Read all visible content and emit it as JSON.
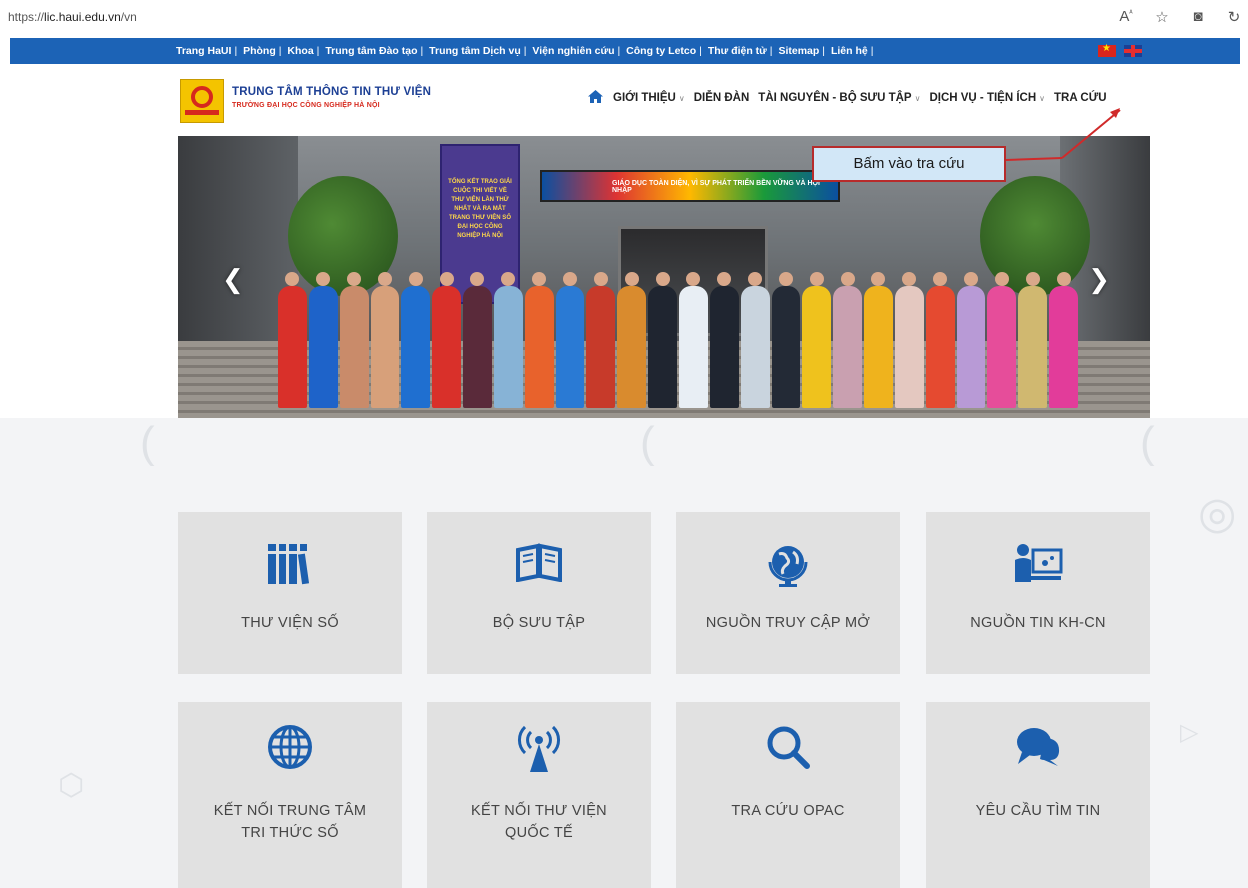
{
  "browser": {
    "url_prefix": "https://",
    "url_host": "lic.haui.edu.vn",
    "url_path": "/vn",
    "icons": [
      "read-aloud-icon",
      "favorite-star-icon",
      "screenshot-icon",
      "reload-icon"
    ]
  },
  "top_links": [
    "Trang HaUI",
    "Phòng",
    "Khoa",
    "Trung tâm Đào tạo",
    "Trung tâm Dịch vụ",
    "Viện nghiên cứu",
    "Công ty Letco",
    "Thư điện tử",
    "Sitemap",
    "Liên hệ"
  ],
  "header": {
    "logo_title": "TRUNG TÂM THÔNG TIN THƯ VIỆN",
    "logo_subtitle": "TRƯỜNG ĐẠI HỌC CÔNG NGHIỆP HÀ NỘI",
    "nav": [
      {
        "label": "GIỚI THIỆU",
        "dropdown": true
      },
      {
        "label": "DIỄN ĐÀN",
        "dropdown": false
      },
      {
        "label": "TÀI NGUYÊN - BỘ SƯU TẬP",
        "dropdown": true
      },
      {
        "label": "DỊCH VỤ - TIỆN ÍCH",
        "dropdown": true
      },
      {
        "label": "TRA CỨU",
        "dropdown": false
      }
    ]
  },
  "hero": {
    "banner_text": "TỔNG KẾT TRAO GIẢI CUỘC THI VIẾT VỀ THƯ VIỆN LẦN THỨ NHẤT VÀ RA MẮT TRANG THƯ VIỆN SỐ ĐẠI HỌC CÔNG NGHIỆP HÀ NỘI",
    "led_text": "GIÁO DỤC TOÀN DIỆN, VÌ SỰ PHÁT TRIỂN BỀN VỮNG VÀ HỘI NHẬP"
  },
  "annotation": {
    "callout": "Bấm vào tra cứu",
    "border_color": "#b72b2b"
  },
  "tiles": [
    {
      "label_lines": [
        "THƯ VIỆN SỐ"
      ],
      "icon": "books-icon"
    },
    {
      "label_lines": [
        "BỘ SƯU TẬP"
      ],
      "icon": "open-book-icon"
    },
    {
      "label_lines": [
        "NGUỒN TRUY CẬP MỞ"
      ],
      "icon": "globe-icon"
    },
    {
      "label_lines": [
        "NGUỒN TIN KH-CN"
      ],
      "icon": "presenter-icon"
    },
    {
      "label_lines": [
        "KẾT NỐI TRUNG TÂM",
        "TRI THỨC SỐ"
      ],
      "icon": "world-grid-icon"
    },
    {
      "label_lines": [
        "KẾT NỐI THƯ VIỆN",
        "QUỐC TẾ"
      ],
      "icon": "broadcast-tower-icon"
    },
    {
      "label_lines": [
        "TRA CỨU OPAC"
      ],
      "icon": "search-icon"
    },
    {
      "label_lines": [
        "YÊU CẦU TÌM TIN"
      ],
      "icon": "chat-bubbles-icon"
    }
  ],
  "colors": {
    "topbar": "#1c63b6",
    "icon": "#1c5fae",
    "tile_bg": "#e1e1e1"
  }
}
